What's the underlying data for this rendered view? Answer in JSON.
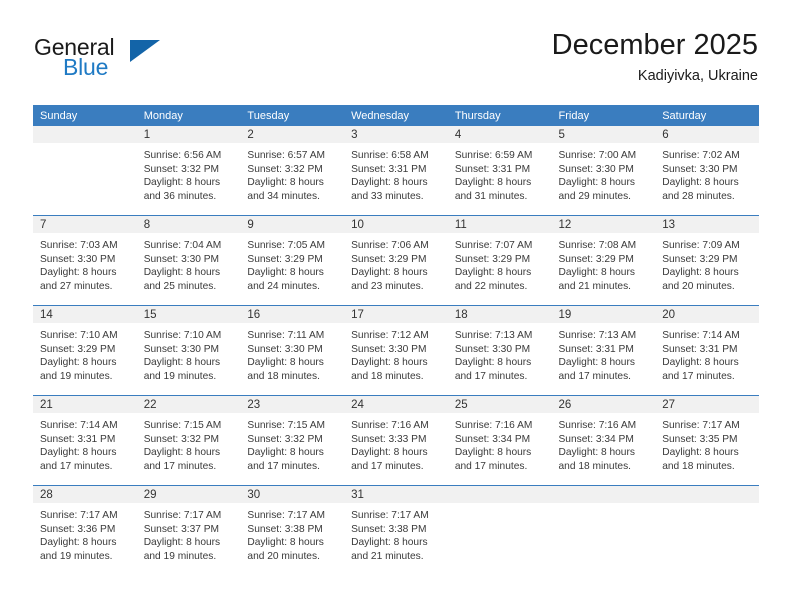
{
  "brand": {
    "word_general": "General",
    "word_blue": "Blue",
    "logo_color": "#1364a8",
    "accent_color": "#1f7ac4"
  },
  "header": {
    "title": "December 2025",
    "subtitle": "Kadiyivka, Ukraine"
  },
  "calendar": {
    "header_bg": "#3a7dbf",
    "daynum_bg": "#f1f1f1",
    "weekdays": [
      "Sunday",
      "Monday",
      "Tuesday",
      "Wednesday",
      "Thursday",
      "Friday",
      "Saturday"
    ],
    "weeks": [
      [
        {
          "day": "",
          "sunrise": "",
          "sunset": "",
          "daylight_l1": "",
          "daylight_l2": ""
        },
        {
          "day": "1",
          "sunrise": "Sunrise: 6:56 AM",
          "sunset": "Sunset: 3:32 PM",
          "daylight_l1": "Daylight: 8 hours",
          "daylight_l2": "and 36 minutes."
        },
        {
          "day": "2",
          "sunrise": "Sunrise: 6:57 AM",
          "sunset": "Sunset: 3:32 PM",
          "daylight_l1": "Daylight: 8 hours",
          "daylight_l2": "and 34 minutes."
        },
        {
          "day": "3",
          "sunrise": "Sunrise: 6:58 AM",
          "sunset": "Sunset: 3:31 PM",
          "daylight_l1": "Daylight: 8 hours",
          "daylight_l2": "and 33 minutes."
        },
        {
          "day": "4",
          "sunrise": "Sunrise: 6:59 AM",
          "sunset": "Sunset: 3:31 PM",
          "daylight_l1": "Daylight: 8 hours",
          "daylight_l2": "and 31 minutes."
        },
        {
          "day": "5",
          "sunrise": "Sunrise: 7:00 AM",
          "sunset": "Sunset: 3:30 PM",
          "daylight_l1": "Daylight: 8 hours",
          "daylight_l2": "and 29 minutes."
        },
        {
          "day": "6",
          "sunrise": "Sunrise: 7:02 AM",
          "sunset": "Sunset: 3:30 PM",
          "daylight_l1": "Daylight: 8 hours",
          "daylight_l2": "and 28 minutes."
        }
      ],
      [
        {
          "day": "7",
          "sunrise": "Sunrise: 7:03 AM",
          "sunset": "Sunset: 3:30 PM",
          "daylight_l1": "Daylight: 8 hours",
          "daylight_l2": "and 27 minutes."
        },
        {
          "day": "8",
          "sunrise": "Sunrise: 7:04 AM",
          "sunset": "Sunset: 3:30 PM",
          "daylight_l1": "Daylight: 8 hours",
          "daylight_l2": "and 25 minutes."
        },
        {
          "day": "9",
          "sunrise": "Sunrise: 7:05 AM",
          "sunset": "Sunset: 3:29 PM",
          "daylight_l1": "Daylight: 8 hours",
          "daylight_l2": "and 24 minutes."
        },
        {
          "day": "10",
          "sunrise": "Sunrise: 7:06 AM",
          "sunset": "Sunset: 3:29 PM",
          "daylight_l1": "Daylight: 8 hours",
          "daylight_l2": "and 23 minutes."
        },
        {
          "day": "11",
          "sunrise": "Sunrise: 7:07 AM",
          "sunset": "Sunset: 3:29 PM",
          "daylight_l1": "Daylight: 8 hours",
          "daylight_l2": "and 22 minutes."
        },
        {
          "day": "12",
          "sunrise": "Sunrise: 7:08 AM",
          "sunset": "Sunset: 3:29 PM",
          "daylight_l1": "Daylight: 8 hours",
          "daylight_l2": "and 21 minutes."
        },
        {
          "day": "13",
          "sunrise": "Sunrise: 7:09 AM",
          "sunset": "Sunset: 3:29 PM",
          "daylight_l1": "Daylight: 8 hours",
          "daylight_l2": "and 20 minutes."
        }
      ],
      [
        {
          "day": "14",
          "sunrise": "Sunrise: 7:10 AM",
          "sunset": "Sunset: 3:29 PM",
          "daylight_l1": "Daylight: 8 hours",
          "daylight_l2": "and 19 minutes."
        },
        {
          "day": "15",
          "sunrise": "Sunrise: 7:10 AM",
          "sunset": "Sunset: 3:30 PM",
          "daylight_l1": "Daylight: 8 hours",
          "daylight_l2": "and 19 minutes."
        },
        {
          "day": "16",
          "sunrise": "Sunrise: 7:11 AM",
          "sunset": "Sunset: 3:30 PM",
          "daylight_l1": "Daylight: 8 hours",
          "daylight_l2": "and 18 minutes."
        },
        {
          "day": "17",
          "sunrise": "Sunrise: 7:12 AM",
          "sunset": "Sunset: 3:30 PM",
          "daylight_l1": "Daylight: 8 hours",
          "daylight_l2": "and 18 minutes."
        },
        {
          "day": "18",
          "sunrise": "Sunrise: 7:13 AM",
          "sunset": "Sunset: 3:30 PM",
          "daylight_l1": "Daylight: 8 hours",
          "daylight_l2": "and 17 minutes."
        },
        {
          "day": "19",
          "sunrise": "Sunrise: 7:13 AM",
          "sunset": "Sunset: 3:31 PM",
          "daylight_l1": "Daylight: 8 hours",
          "daylight_l2": "and 17 minutes."
        },
        {
          "day": "20",
          "sunrise": "Sunrise: 7:14 AM",
          "sunset": "Sunset: 3:31 PM",
          "daylight_l1": "Daylight: 8 hours",
          "daylight_l2": "and 17 minutes."
        }
      ],
      [
        {
          "day": "21",
          "sunrise": "Sunrise: 7:14 AM",
          "sunset": "Sunset: 3:31 PM",
          "daylight_l1": "Daylight: 8 hours",
          "daylight_l2": "and 17 minutes."
        },
        {
          "day": "22",
          "sunrise": "Sunrise: 7:15 AM",
          "sunset": "Sunset: 3:32 PM",
          "daylight_l1": "Daylight: 8 hours",
          "daylight_l2": "and 17 minutes."
        },
        {
          "day": "23",
          "sunrise": "Sunrise: 7:15 AM",
          "sunset": "Sunset: 3:32 PM",
          "daylight_l1": "Daylight: 8 hours",
          "daylight_l2": "and 17 minutes."
        },
        {
          "day": "24",
          "sunrise": "Sunrise: 7:16 AM",
          "sunset": "Sunset: 3:33 PM",
          "daylight_l1": "Daylight: 8 hours",
          "daylight_l2": "and 17 minutes."
        },
        {
          "day": "25",
          "sunrise": "Sunrise: 7:16 AM",
          "sunset": "Sunset: 3:34 PM",
          "daylight_l1": "Daylight: 8 hours",
          "daylight_l2": "and 17 minutes."
        },
        {
          "day": "26",
          "sunrise": "Sunrise: 7:16 AM",
          "sunset": "Sunset: 3:34 PM",
          "daylight_l1": "Daylight: 8 hours",
          "daylight_l2": "and 18 minutes."
        },
        {
          "day": "27",
          "sunrise": "Sunrise: 7:17 AM",
          "sunset": "Sunset: 3:35 PM",
          "daylight_l1": "Daylight: 8 hours",
          "daylight_l2": "and 18 minutes."
        }
      ],
      [
        {
          "day": "28",
          "sunrise": "Sunrise: 7:17 AM",
          "sunset": "Sunset: 3:36 PM",
          "daylight_l1": "Daylight: 8 hours",
          "daylight_l2": "and 19 minutes."
        },
        {
          "day": "29",
          "sunrise": "Sunrise: 7:17 AM",
          "sunset": "Sunset: 3:37 PM",
          "daylight_l1": "Daylight: 8 hours",
          "daylight_l2": "and 19 minutes."
        },
        {
          "day": "30",
          "sunrise": "Sunrise: 7:17 AM",
          "sunset": "Sunset: 3:38 PM",
          "daylight_l1": "Daylight: 8 hours",
          "daylight_l2": "and 20 minutes."
        },
        {
          "day": "31",
          "sunrise": "Sunrise: 7:17 AM",
          "sunset": "Sunset: 3:38 PM",
          "daylight_l1": "Daylight: 8 hours",
          "daylight_l2": "and 21 minutes."
        },
        {
          "day": "",
          "sunrise": "",
          "sunset": "",
          "daylight_l1": "",
          "daylight_l2": ""
        },
        {
          "day": "",
          "sunrise": "",
          "sunset": "",
          "daylight_l1": "",
          "daylight_l2": ""
        },
        {
          "day": "",
          "sunrise": "",
          "sunset": "",
          "daylight_l1": "",
          "daylight_l2": ""
        }
      ]
    ]
  }
}
